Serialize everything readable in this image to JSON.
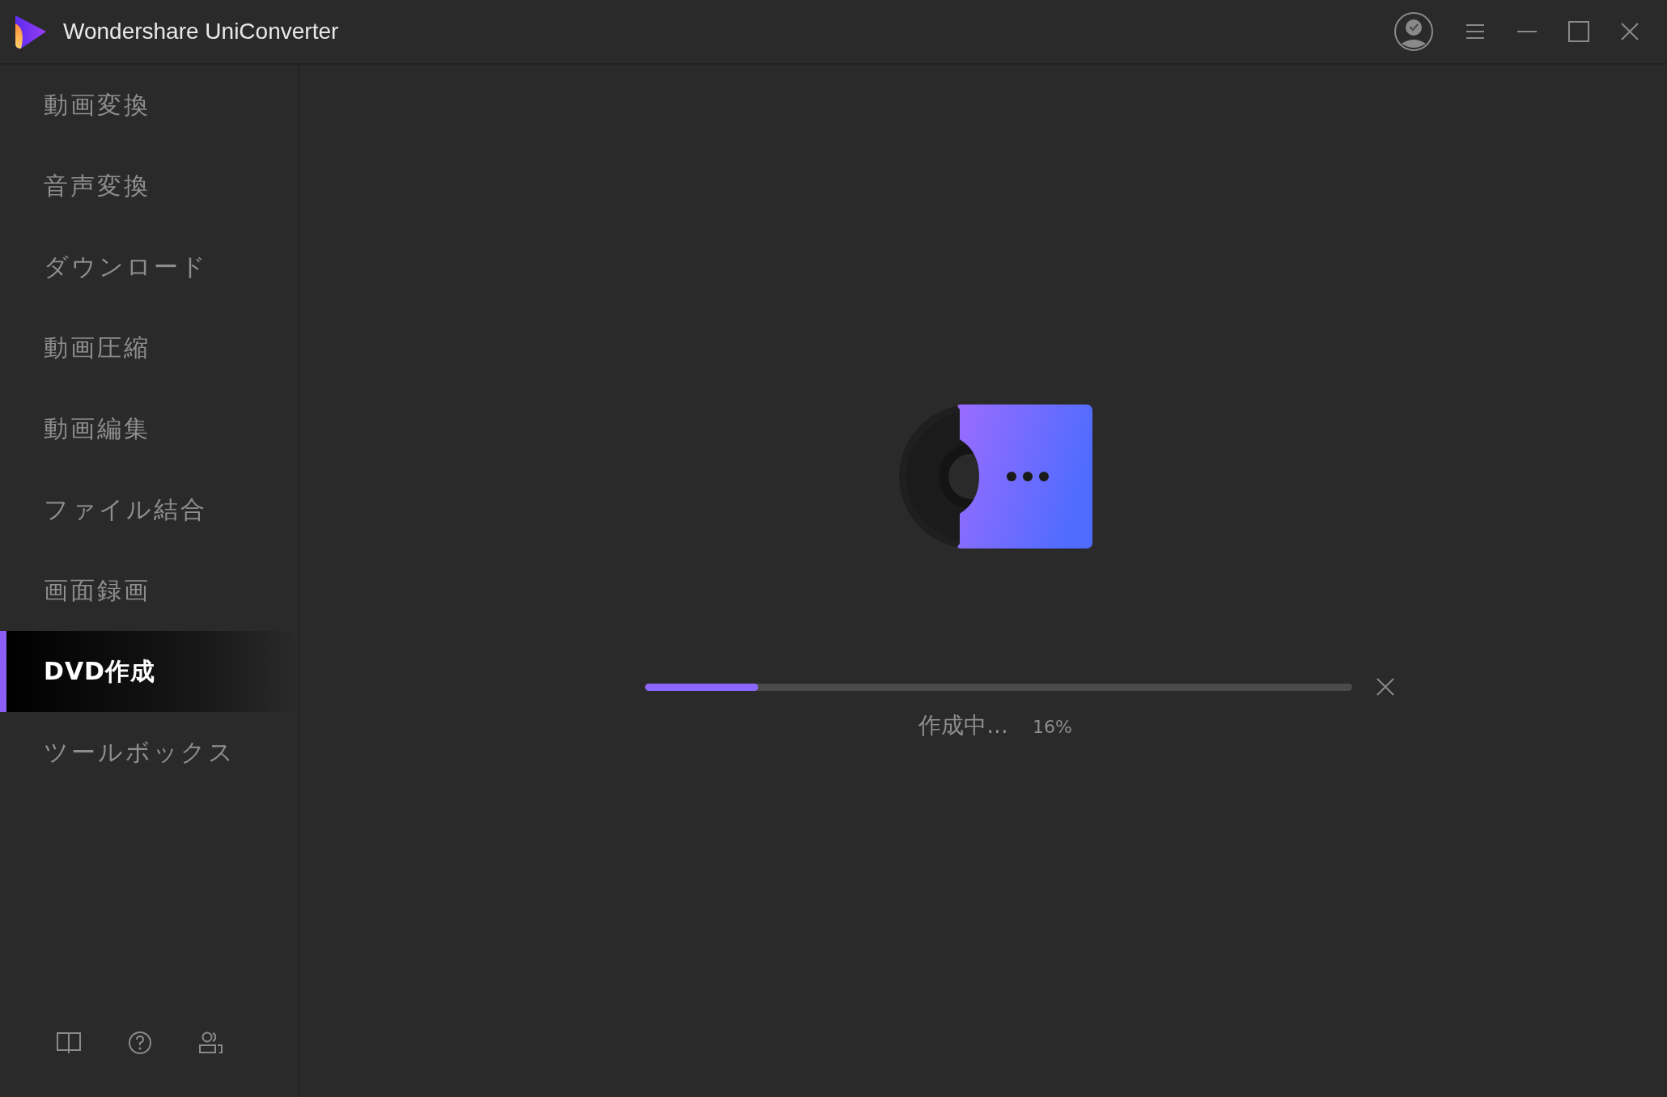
{
  "window": {
    "title": "Wondershare UniConverter"
  },
  "sidebar": {
    "items": [
      {
        "label": "動画変換",
        "selected": false
      },
      {
        "label": "音声変換",
        "selected": false
      },
      {
        "label": "ダウンロード",
        "selected": false
      },
      {
        "label": "動画圧縮",
        "selected": false
      },
      {
        "label": "動画編集",
        "selected": false
      },
      {
        "label": "ファイル結合",
        "selected": false
      },
      {
        "label": "画面録画",
        "selected": false
      },
      {
        "label": "DVD作成",
        "selected": true
      },
      {
        "label": "ツールボックス",
        "selected": false
      }
    ]
  },
  "progress": {
    "level": 0.16,
    "status": "作成中...",
    "percent": "16%"
  }
}
